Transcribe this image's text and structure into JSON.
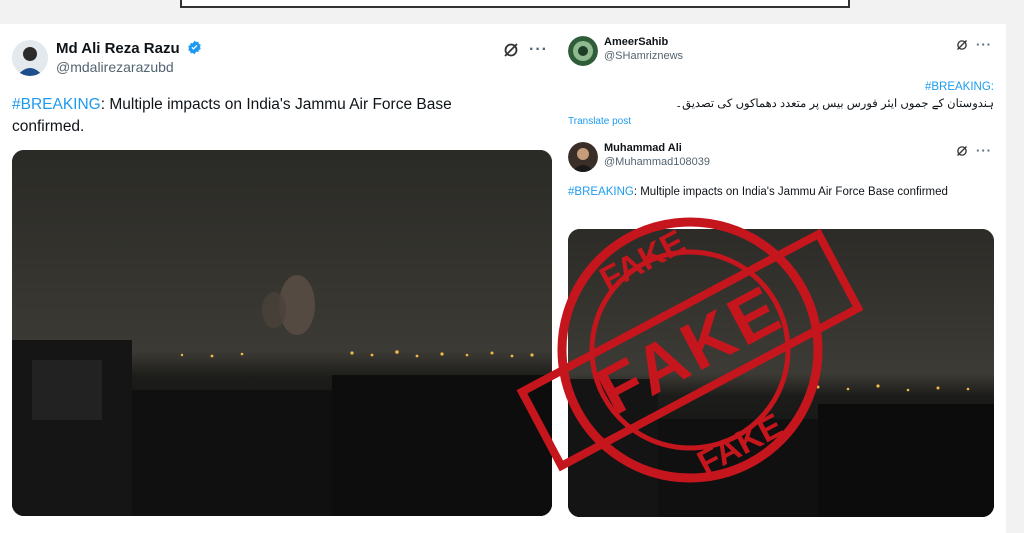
{
  "left_tweet": {
    "display_name": "Md Ali Reza Razu",
    "handle": "@mdalirezarazubd",
    "hashtag": "#BREAKING",
    "text": ": Multiple impacts on India's Jammu Air Force Base confirmed.",
    "icons": [
      "grok-icon",
      "more-icon",
      "verified-icon"
    ]
  },
  "right_tweet_1": {
    "display_name": "AmeerSahib",
    "handle": "@SHamriznews",
    "hashtag": "#BREAKING:",
    "text": "ہندوستان کے جموں ایئر فورس بیس پر متعدد دھماکوں کی تصدیق۔",
    "translate_label": "Translate post"
  },
  "right_tweet_2": {
    "display_name": "Muhammad Ali",
    "handle": "@Muhammad108039",
    "hashtag": "#BREAKING",
    "text": ": Multiple impacts on India's Jammu Air Force Base confirmed"
  },
  "stamp": {
    "label": "FAKE",
    "color": "#c4161c"
  },
  "colors": {
    "link": "#1d9bf0",
    "text": "#0f1419",
    "muted": "#536471"
  }
}
